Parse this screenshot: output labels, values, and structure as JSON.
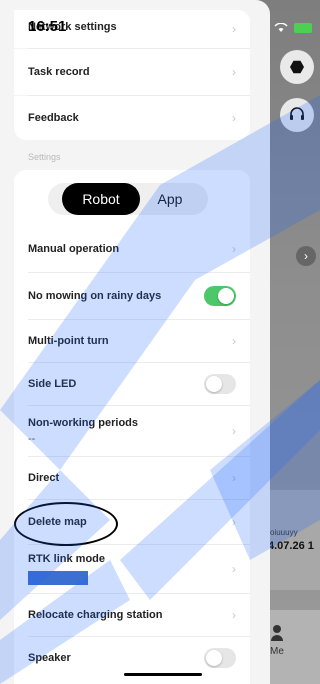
{
  "status": {
    "time": "16:51"
  },
  "rows_top": [
    {
      "label": "Network settings"
    },
    {
      "label": "Task record"
    },
    {
      "label": "Feedback"
    }
  ],
  "settings_title": "Settings",
  "segmented": {
    "robot": "Robot",
    "app": "App",
    "active": "Robot"
  },
  "rows_settings": {
    "manual_operation": "Manual operation",
    "no_mowing_rain": "No mowing on rainy days",
    "no_mowing_rain_toggle": "on",
    "multipoint_turn": "Multi-point turn",
    "side_led": "Side LED",
    "side_led_toggle": "off",
    "non_working_periods": "Non-working periods",
    "non_working_periods_value": "--",
    "direct": "Direct",
    "delete_map": "Delete map",
    "rtk_link_mode": "RTK link mode",
    "relocate_charging_station": "Relocate charging station",
    "speaker": "Speaker",
    "speaker_toggle": "off"
  },
  "background_app": {
    "card_name": "oiuuuyy",
    "card_date": "4.07.26 1",
    "nav_me": "Me"
  },
  "colors": {
    "toggle_on": "#4cc86a",
    "blue_bar": "#3b6fd0",
    "watermark": "#1b64ff"
  }
}
